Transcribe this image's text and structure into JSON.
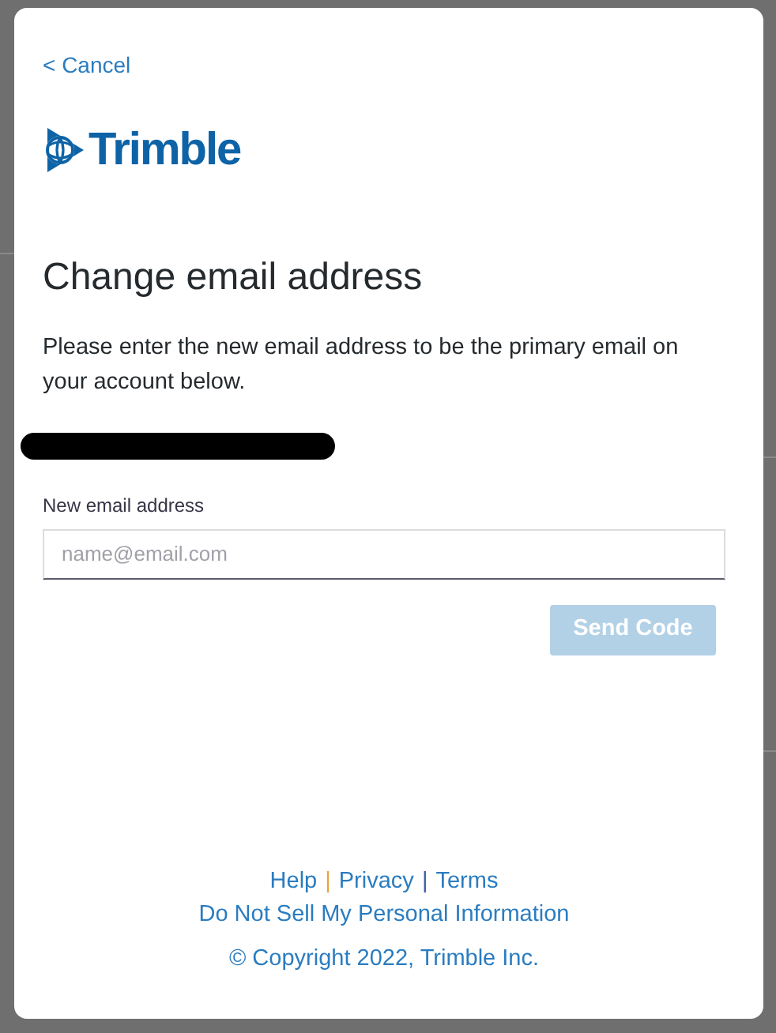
{
  "cancel_link": "< Cancel",
  "logo": {
    "text": "Trimble"
  },
  "title": "Change email address",
  "description": "Please enter the new email address to be the primary email on your account below.",
  "email_field": {
    "label": "New email address",
    "placeholder": "name@email.com"
  },
  "send_button": {
    "label": "Send Code",
    "disabled": true
  },
  "footer": {
    "links": [
      {
        "label": "Help"
      },
      {
        "label": "Privacy"
      },
      {
        "label": "Terms"
      }
    ],
    "separators": [
      {
        "text": "|",
        "color": "#e8a33d"
      },
      {
        "text": "|",
        "color": "#3a5ea8"
      }
    ],
    "privacy_link": "Do Not Sell My Personal Information",
    "copyright": "© Copyright 2022, Trimble Inc."
  }
}
